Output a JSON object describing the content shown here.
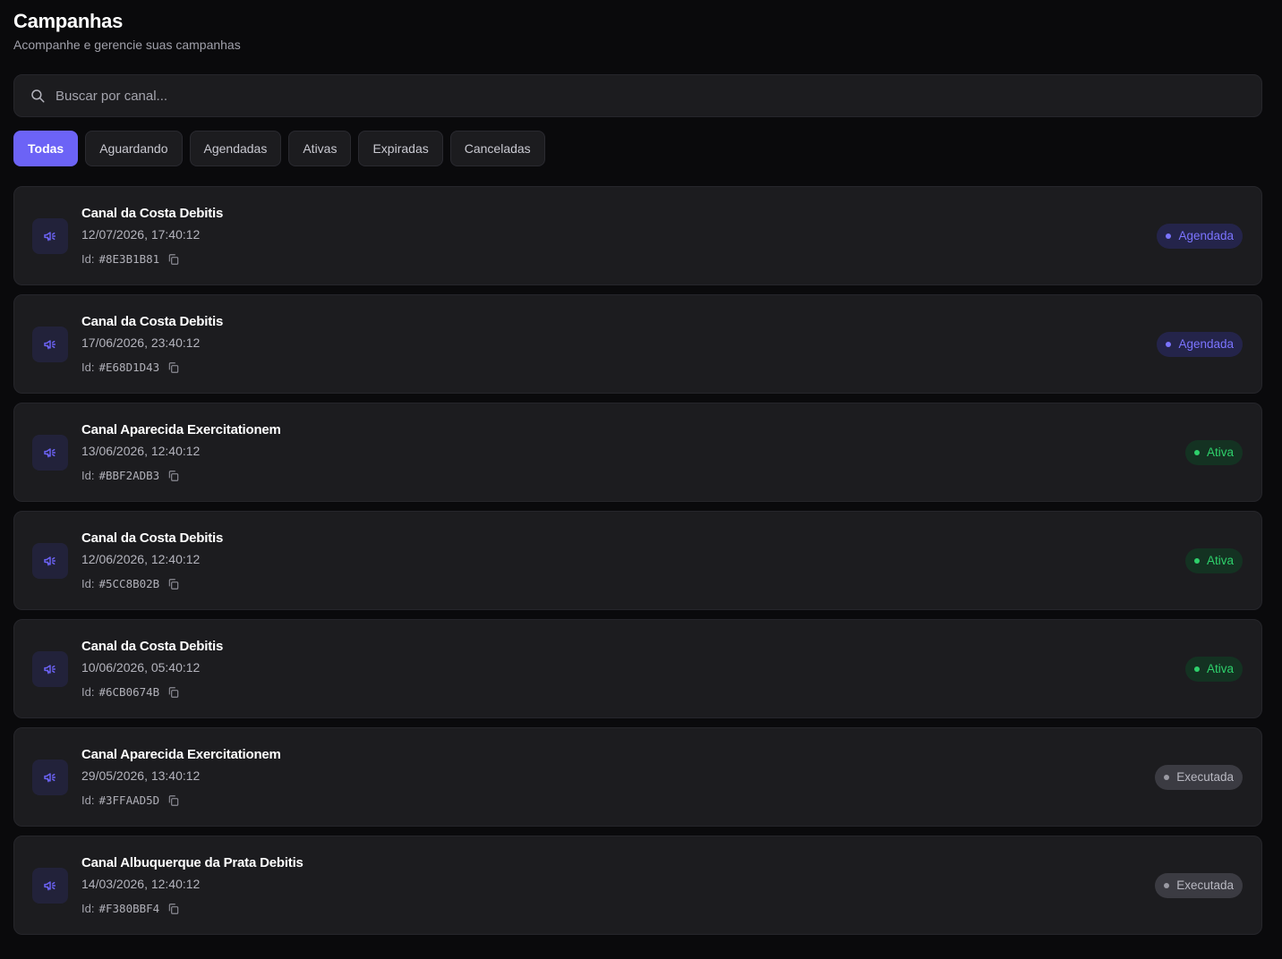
{
  "header": {
    "title": "Campanhas",
    "subtitle": "Acompanhe e gerencie suas campanhas"
  },
  "search": {
    "placeholder": "Buscar por canal...",
    "value": "",
    "icon": "search-icon"
  },
  "filters": [
    {
      "label": "Todas",
      "active": true
    },
    {
      "label": "Aguardando",
      "active": false
    },
    {
      "label": "Agendadas",
      "active": false
    },
    {
      "label": "Ativas",
      "active": false
    },
    {
      "label": "Expiradas",
      "active": false
    },
    {
      "label": "Canceladas",
      "active": false
    }
  ],
  "id_label": "Id:",
  "colors": {
    "accent": "#6c63f6",
    "agendada": "#7b74ff",
    "ativa": "#2ed06b",
    "executada": "#b9b9c2",
    "card_bg": "#1c1c1f",
    "page_bg": "#0a0a0c"
  },
  "campaigns": [
    {
      "title": "Canal da Costa Debitis",
      "date": "12/07/2026, 17:40:12",
      "id": "#8E3B1B81",
      "status": "Agendada",
      "status_key": "agendada",
      "icon": "megaphone-icon"
    },
    {
      "title": "Canal da Costa Debitis",
      "date": "17/06/2026, 23:40:12",
      "id": "#E68D1D43",
      "status": "Agendada",
      "status_key": "agendada",
      "icon": "megaphone-icon"
    },
    {
      "title": "Canal Aparecida Exercitationem",
      "date": "13/06/2026, 12:40:12",
      "id": "#BBF2ADB3",
      "status": "Ativa",
      "status_key": "ativa",
      "icon": "megaphone-icon"
    },
    {
      "title": "Canal da Costa Debitis",
      "date": "12/06/2026, 12:40:12",
      "id": "#5CC8B02B",
      "status": "Ativa",
      "status_key": "ativa",
      "icon": "megaphone-icon"
    },
    {
      "title": "Canal da Costa Debitis",
      "date": "10/06/2026, 05:40:12",
      "id": "#6CB0674B",
      "status": "Ativa",
      "status_key": "ativa",
      "icon": "megaphone-icon"
    },
    {
      "title": "Canal Aparecida Exercitationem",
      "date": "29/05/2026, 13:40:12",
      "id": "#3FFAAD5D",
      "status": "Executada",
      "status_key": "executada",
      "icon": "megaphone-icon"
    },
    {
      "title": "Canal Albuquerque da Prata Debitis",
      "date": "14/03/2026, 12:40:12",
      "id": "#F380BBF4",
      "status": "Executada",
      "status_key": "executada",
      "icon": "megaphone-icon"
    }
  ]
}
